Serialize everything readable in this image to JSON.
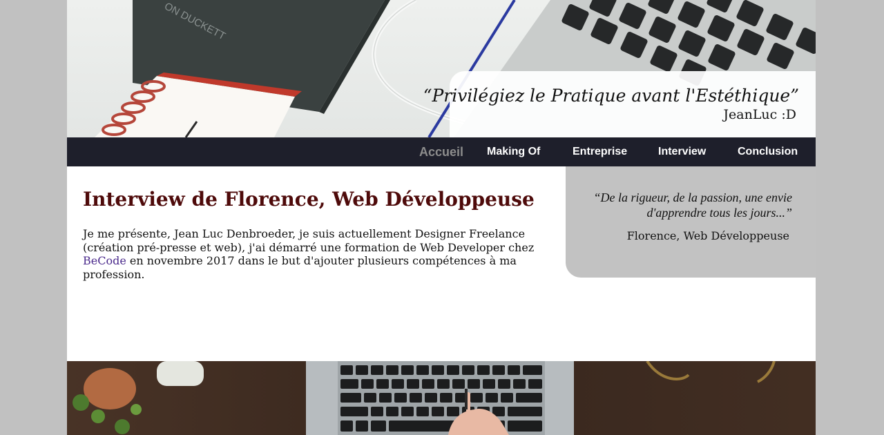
{
  "hero": {
    "quote": "“Privilégiez le Pratique avant l'Estéthique”",
    "author": "JeanLuc :D",
    "book_text": "ON DUCKETT"
  },
  "nav": {
    "items": [
      {
        "label": "Accueil",
        "active": true
      },
      {
        "label": "Making Of",
        "active": false
      },
      {
        "label": "Entreprise",
        "active": false
      },
      {
        "label": "Interview",
        "active": false
      },
      {
        "label": "Conclusion",
        "active": false
      }
    ]
  },
  "main": {
    "title": "Interview de Florence, Web Développeuse",
    "intro_before": "Je me présente, Jean Luc Denbroeder, je suis actuellement Designer Freelance (création pré-presse et web), j'ai démarré une formation de Web Developer chez",
    "intro_link": "BeCode",
    "intro_after": "en novembre 2017 dans le but d'ajouter plusieurs compétences à ma profession."
  },
  "aside": {
    "quote": "“De la rigueur, de la passion, une envie d'apprendre tous les jours...”",
    "author": "Florence, Web Développeuse"
  },
  "colors": {
    "page_background": "#c1c1c1",
    "nav_background": "#1e1f2b",
    "title_color": "#4e0a0a",
    "link_color": "#4b2a8c",
    "aside_background": "#c2c2c2"
  }
}
